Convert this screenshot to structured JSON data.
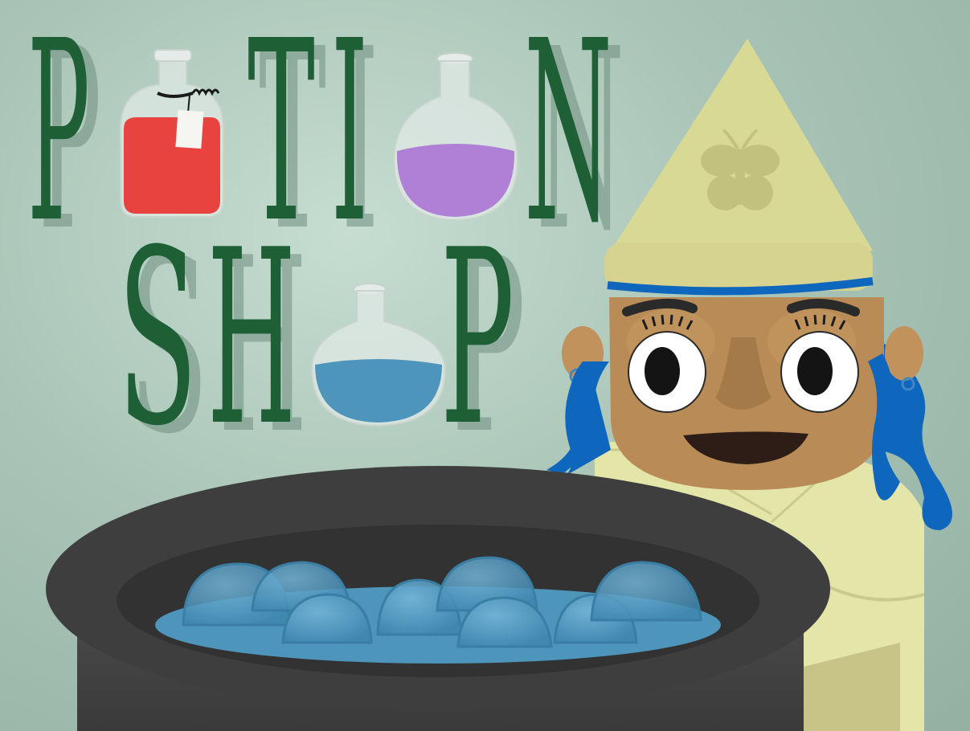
{
  "screen": "title",
  "title": {
    "line1": [
      "P",
      "T",
      "I",
      "N"
    ],
    "line2": [
      "S",
      "H",
      "P"
    ]
  },
  "colors": {
    "background": "#aac5b7",
    "title_text": "#1f5f35",
    "red_potion": "#e8433f",
    "purple_potion": "#b07fd6",
    "blue_potion": "#4e95bb",
    "cauldron": "#3c3c3c",
    "witch_hair": "#0f66bd",
    "witch_hat": "#d9d996",
    "witch_skin": "#b88a55",
    "witch_robe": "#e3e6a8"
  },
  "icons": [
    "red-potion-bottle-icon",
    "purple-potion-flask-icon",
    "blue-potion-flask-icon",
    "butterfly-icon"
  ]
}
